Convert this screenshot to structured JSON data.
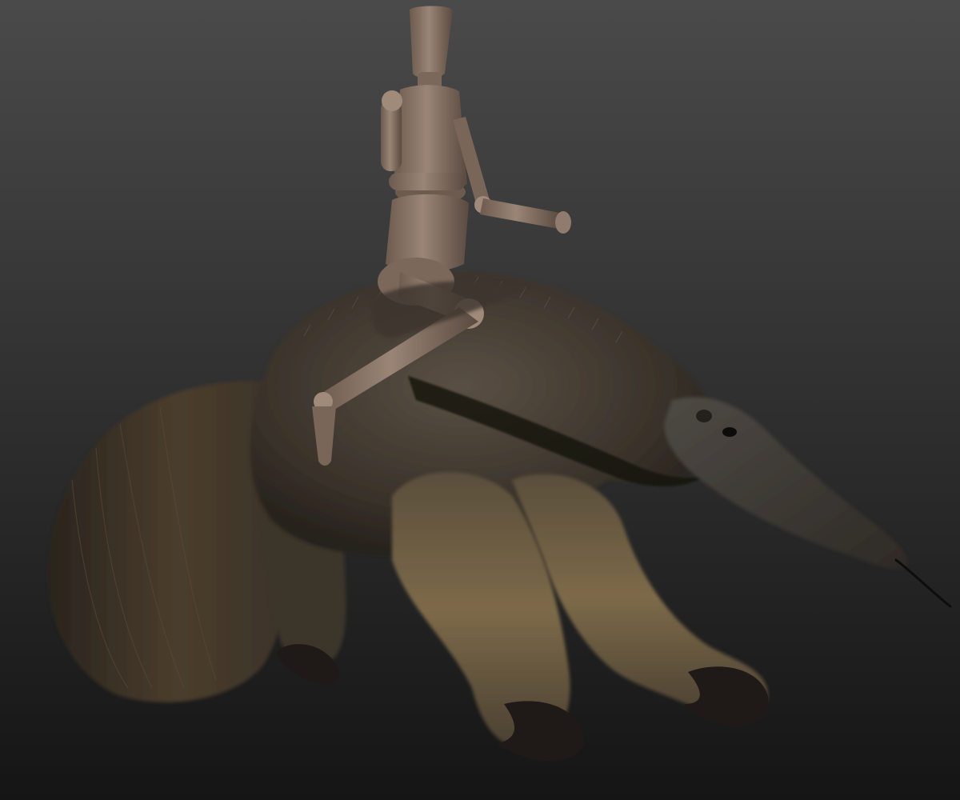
{
  "viewport": {
    "background_top": "#4a4a4a",
    "background_bottom": "#151515"
  },
  "scene": {
    "subject": "anteater-3d-model",
    "rider": "wooden-mannequin-figure",
    "colors": {
      "fur_dark": "#2b2620",
      "fur_mid": "#4a4237",
      "fur_light": "#7a6a4e",
      "fur_tan": "#8a7650",
      "claw": "#1f1a18",
      "mannequin": "#8f7c6e",
      "mannequin_shade": "#5e4d43",
      "mannequin_joint": "#a08a7a",
      "tongue": "#0d0d0d"
    }
  }
}
